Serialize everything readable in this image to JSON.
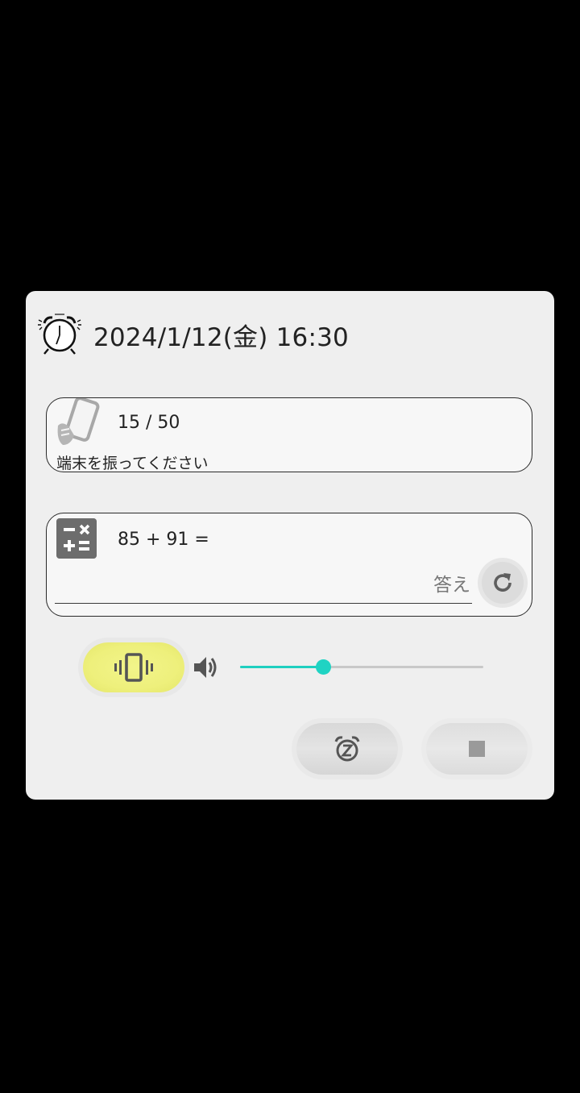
{
  "header": {
    "datetime": "2024/1/12(金) 16:30"
  },
  "shake_task": {
    "count": "15 / 50",
    "instruction": "端末を振ってください"
  },
  "math_task": {
    "equation": "85 + 91 =",
    "answer_value": "",
    "answer_placeholder": "答え"
  },
  "controls": {
    "vibration_enabled": true,
    "volume_level": 0.34
  },
  "icons": {
    "alarm": "alarm-clock-icon",
    "shake": "shake-phone-icon",
    "calculator": "calculator-icon",
    "refresh": "refresh-icon",
    "vibrate": "vibrate-icon",
    "speaker": "speaker-icon",
    "snooze": "snooze-icon",
    "stop": "stop-icon"
  },
  "colors": {
    "vibrate_active": "#eef07c",
    "slider_accent": "#1fd3c3"
  }
}
